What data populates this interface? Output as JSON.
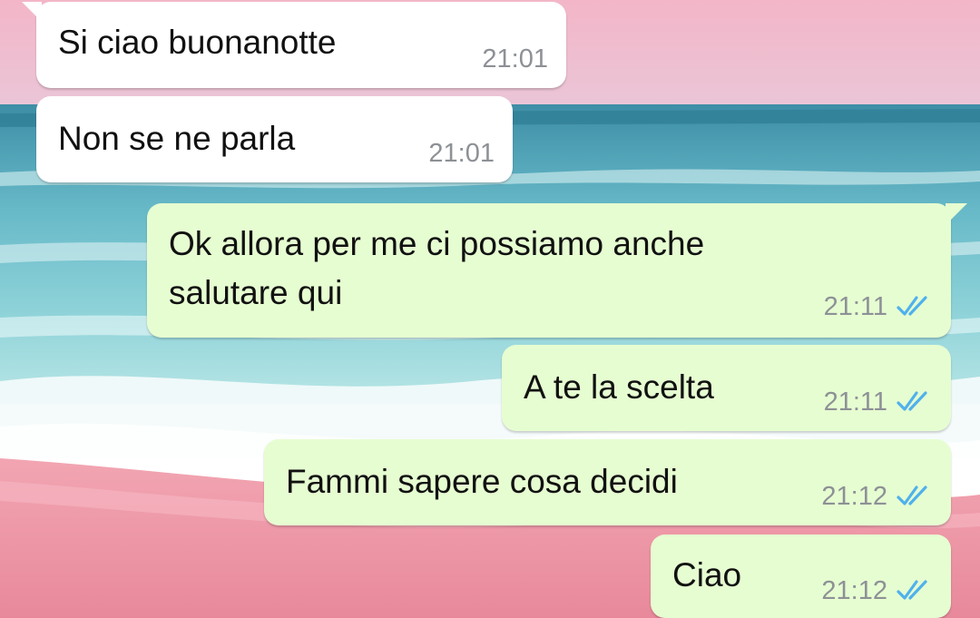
{
  "chat": {
    "messages": [
      {
        "direction": "incoming",
        "text": "Si ciao buonanotte",
        "time": "21:01",
        "status": ""
      },
      {
        "direction": "incoming",
        "text": "Non se ne parla",
        "time": "21:01",
        "status": ""
      },
      {
        "direction": "outgoing",
        "text": "Ok allora per me ci possiamo anche salutare qui",
        "time": "21:11",
        "status": "read-double-check-icon"
      },
      {
        "direction": "outgoing",
        "text": "A te la scelta",
        "time": "21:11",
        "status": "read-double-check-icon"
      },
      {
        "direction": "outgoing",
        "text": "Fammi sapere cosa decidi",
        "time": "21:12",
        "status": "read-double-check-icon"
      },
      {
        "direction": "outgoing",
        "text": "Ciao",
        "time": "21:12",
        "status": "read-double-check-icon"
      }
    ]
  },
  "theme": {
    "incoming_bubble": "#ffffff",
    "outgoing_bubble": "#e6fdd1",
    "timestamp": "#8d9196",
    "read_tick": "#4fb1ec",
    "wallpaper": "pink-beach-sea"
  }
}
